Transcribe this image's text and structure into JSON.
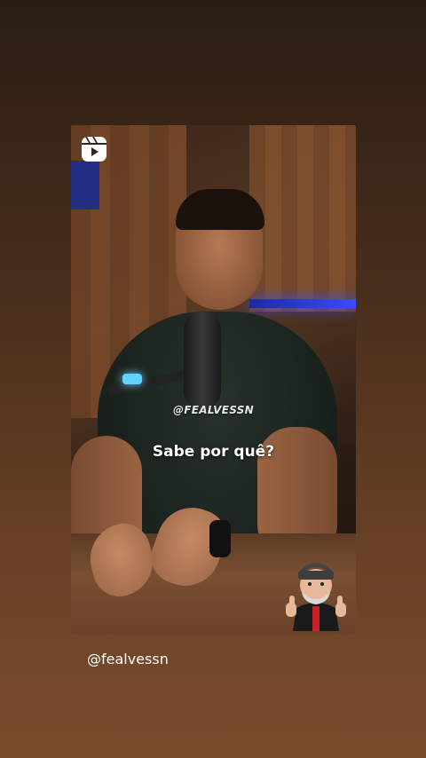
{
  "story": {
    "video": {
      "source_icon": "reels-icon",
      "handle_overlay": "@FEALVESSN",
      "caption": "Sabe por quê?",
      "sticker": "thumbs-up-avatar-sticker"
    },
    "mention": "@fealvessn"
  },
  "colors": {
    "background_top": "#2a1d14",
    "background_bottom": "#7a4c2c",
    "caption_text": "#ffffff"
  }
}
